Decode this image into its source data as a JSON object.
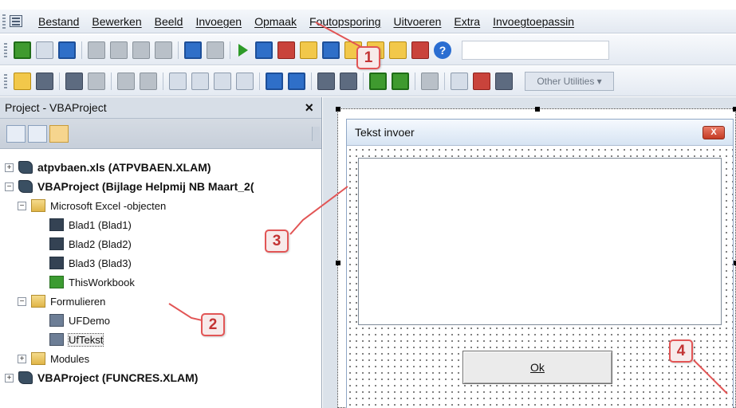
{
  "menu_bar": {
    "items": [
      "Bestand",
      "Bewerken",
      "Beeld",
      "Invoegen",
      "Opmaak",
      "Foutopsporing",
      "Uitvoeren",
      "Extra",
      "Invoegtoepassin"
    ]
  },
  "toolbar": {
    "other_utilities_label": "Other Utilities ▾",
    "help_label": "?"
  },
  "project_explorer": {
    "title": "Project - VBAProject",
    "close_label": "×",
    "tree": [
      {
        "label": "atpvbaen.xls (ATPVBAEN.XLAM)",
        "toggle": "+",
        "icon": "vba-project-icon"
      },
      {
        "label": "VBAProject (Bijlage Helpmij NB Maart_2(",
        "toggle": "−",
        "icon": "vba-project-icon"
      },
      {
        "label": "Microsoft Excel -objecten",
        "toggle": "−",
        "icon": "folder-icon"
      },
      {
        "label": "Blad1 (Blad1)",
        "icon": "worksheet-icon"
      },
      {
        "label": "Blad2 (Blad2)",
        "icon": "worksheet-icon"
      },
      {
        "label": "Blad3 (Blad3)",
        "icon": "worksheet-icon"
      },
      {
        "label": "ThisWorkbook",
        "icon": "workbook-icon"
      },
      {
        "label": "Formulieren",
        "toggle": "−",
        "icon": "folder-icon"
      },
      {
        "label": "UFDemo",
        "icon": "userform-icon"
      },
      {
        "label": "UfTekst",
        "icon": "userform-icon"
      },
      {
        "label": "Modules",
        "toggle": "+",
        "icon": "folder-icon"
      },
      {
        "label": "VBAProject (FUNCRES.XLAM)",
        "toggle": "+",
        "icon": "vba-project-icon"
      }
    ]
  },
  "designer": {
    "form_title": "Tekst invoer",
    "form_close_label": "X",
    "ok_button_label": "Ok"
  },
  "callouts": [
    "1",
    "2",
    "3",
    "4"
  ],
  "colors": {
    "callout_border": "#e25555",
    "callout_text": "#c33333",
    "toolbar_background": "#e4eaf2"
  }
}
